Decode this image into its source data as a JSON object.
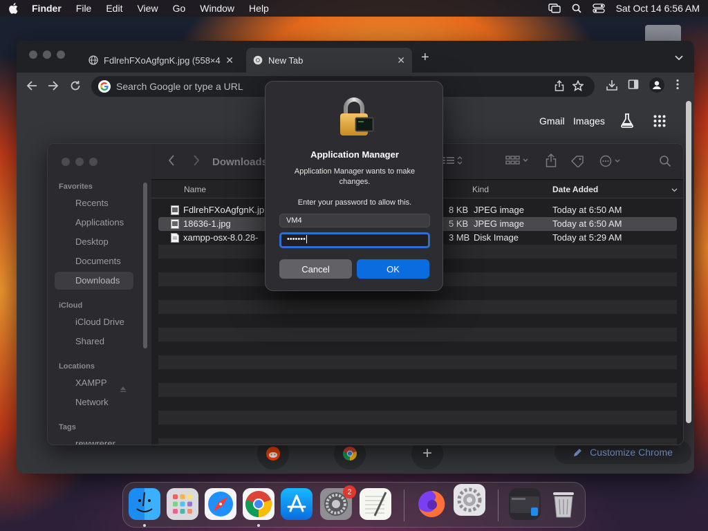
{
  "menubar": {
    "app": "Finder",
    "items": [
      "File",
      "Edit",
      "View",
      "Go",
      "Window",
      "Help"
    ],
    "clock": "Sat Oct 14  6:56 AM"
  },
  "chrome": {
    "tabs": [
      {
        "label": "FdlrehFXoAgfgnK.jpg (558×4",
        "icon": "globe-icon"
      },
      {
        "label": "New Tab",
        "icon": "chrome-icon"
      }
    ],
    "omnibox_placeholder": "Search Google or type a URL",
    "ntp": {
      "gmail": "Gmail",
      "images": "Images",
      "customize": "Customize Chrome"
    }
  },
  "finder": {
    "title": "Downloads",
    "sidebar": {
      "favorites_header": "Favorites",
      "favorites": [
        "Recents",
        "Applications",
        "Desktop",
        "Documents",
        "Downloads"
      ],
      "icloud_header": "iCloud",
      "icloud": [
        "iCloud Drive",
        "Shared"
      ],
      "locations_header": "Locations",
      "locations": [
        "XAMPP",
        "Network"
      ],
      "tags_header": "Tags",
      "tags": [
        "rewwrerer"
      ]
    },
    "columns": {
      "name": "Name",
      "kind": "Kind",
      "date": "Date Added"
    },
    "files": [
      {
        "name": "FdlrehFXoAgfgnK.jp",
        "size": "8 KB",
        "kind": "JPEG image",
        "date": "Today at 6:50 AM"
      },
      {
        "name": "18636-1.jpg",
        "size": "5 KB",
        "kind": "JPEG image",
        "date": "Today at 6:50 AM"
      },
      {
        "name": "xampp-osx-8.0.28-",
        "size": "3 MB",
        "kind": "Disk Image",
        "date": "Today at 5:29 AM"
      }
    ]
  },
  "dialog": {
    "title": "Application Manager",
    "message": "Application Manager wants to make changes.",
    "prompt": "Enter your password to allow this.",
    "username": "VM4",
    "password_mask": "•••••••",
    "cancel": "Cancel",
    "ok": "OK"
  },
  "dock": {
    "apps": [
      "finder",
      "launchpad",
      "safari",
      "chrome",
      "app-store",
      "system-settings",
      "textedit",
      "firefox",
      "settings-utility",
      "screen-sharing",
      "trash"
    ],
    "settings_badge": "2"
  },
  "colors": {
    "accent": "#0a6ddf",
    "link": "#8ab4f8",
    "badge": "#e0382e"
  }
}
